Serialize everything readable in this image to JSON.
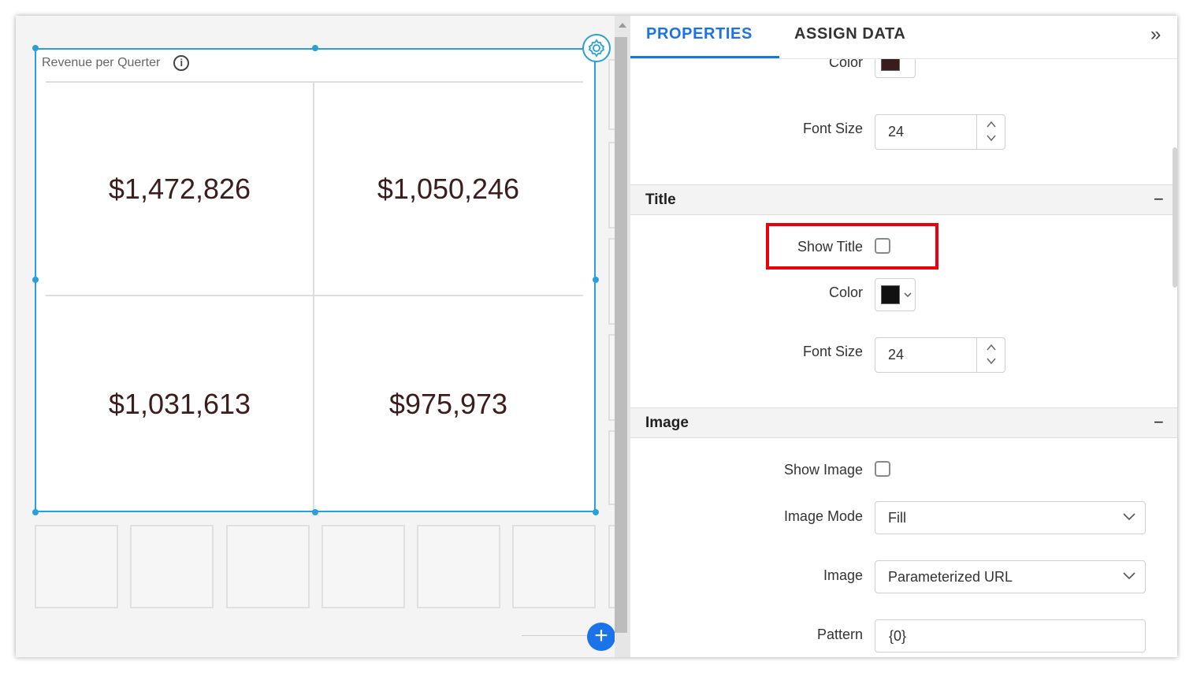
{
  "widget": {
    "title": "Revenue per Querter",
    "cells": [
      "$1,472,826",
      "$1,050,246",
      "$1,031,613",
      "$975,973"
    ]
  },
  "panel": {
    "tabs": [
      "PROPERTIES",
      "ASSIGN DATA"
    ],
    "active_tab": "PROPERTIES",
    "top_partial": {
      "color_label": "Color",
      "font_size_label": "Font Size",
      "font_size_value": "24"
    },
    "title_section": {
      "header": "Title",
      "collapse_symbol": "−",
      "show_title_label": "Show Title",
      "show_title_checked": false,
      "color_label": "Color",
      "color_value": "#000000",
      "font_size_label": "Font Size",
      "font_size_value": "24"
    },
    "image_section": {
      "header": "Image",
      "collapse_symbol": "−",
      "show_image_label": "Show Image",
      "show_image_checked": false,
      "image_mode_label": "Image Mode",
      "image_mode_value": "Fill",
      "image_label": "Image",
      "image_value": "Parameterized URL",
      "pattern_label": "Pattern",
      "pattern_value": "{0}"
    }
  },
  "colors": {
    "accent": "#1a73e8",
    "selection": "#2aa0d8",
    "highlight": "#e8000b",
    "value_text": "#3b1d1d"
  }
}
